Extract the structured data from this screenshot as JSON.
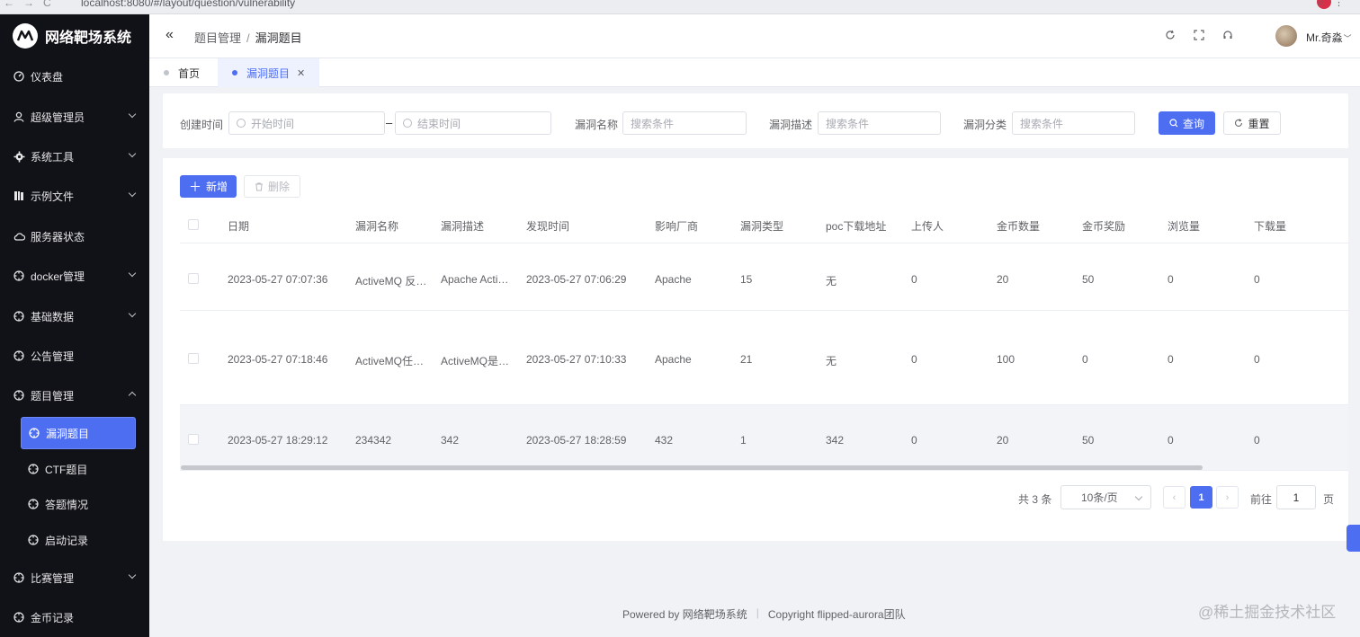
{
  "browser": {
    "url": "localhost:8080/#/layout/question/vulnerability"
  },
  "app": {
    "title": "网络靶场系统"
  },
  "sidebar": {
    "items": [
      {
        "label": "仪表盘",
        "icon": "dashboard-icon"
      },
      {
        "label": "超级管理员",
        "icon": "user-icon"
      },
      {
        "label": "系统工具",
        "icon": "tools-icon"
      },
      {
        "label": "示例文件",
        "icon": "folder-icon"
      },
      {
        "label": "服务器状态",
        "icon": "cloud-icon"
      },
      {
        "label": "docker管理",
        "icon": "aim-icon"
      },
      {
        "label": "基础数据",
        "icon": "aim-icon"
      },
      {
        "label": "公告管理",
        "icon": "aim-icon"
      },
      {
        "label": "题目管理",
        "icon": "aim-icon"
      },
      {
        "label": "比赛管理",
        "icon": "aim-icon"
      },
      {
        "label": "金币记录",
        "icon": "aim-icon"
      }
    ],
    "sub_items": [
      {
        "label": "漏洞题目",
        "active": true
      },
      {
        "label": "CTF题目",
        "active": false
      },
      {
        "label": "答题情况",
        "active": false
      },
      {
        "label": "启动记录",
        "active": false
      }
    ]
  },
  "header": {
    "breadcrumb_parent": "题目管理",
    "breadcrumb_sep": "/",
    "breadcrumb_current": "漏洞题目",
    "username": "Mr.奇淼"
  },
  "tabs": [
    {
      "label": "首页",
      "active": false
    },
    {
      "label": "漏洞题目",
      "active": true
    }
  ],
  "search": {
    "created_label": "创建时间",
    "start_placeholder": "开始时间",
    "range_sep": "–",
    "end_placeholder": "结束时间",
    "name_label": "漏洞名称",
    "name_placeholder": "搜索条件",
    "desc_label": "漏洞描述",
    "desc_placeholder": "搜索条件",
    "category_label": "漏洞分类",
    "category_placeholder": "搜索条件",
    "query_label": "查询",
    "reset_label": "重置"
  },
  "toolbar": {
    "add_label": "新增",
    "delete_label": "删除"
  },
  "table": {
    "columns": [
      "日期",
      "漏洞名称",
      "漏洞描述",
      "发现时间",
      "影响厂商",
      "漏洞类型",
      "poc下载地址",
      "上传人",
      "金币数量",
      "金币奖励",
      "浏览量",
      "下载量"
    ],
    "rows": [
      [
        "2023-05-27 07:07:36",
        "ActiveMQ 反…",
        "Apache Acti…",
        "2023-05-27 07:06:29",
        "Apache",
        "15",
        "无",
        "0",
        "20",
        "50",
        "0",
        "0"
      ],
      [
        "2023-05-27 07:18:46",
        "ActiveMQ任…",
        "ActiveMQ是…",
        "2023-05-27 07:10:33",
        "Apache",
        "21",
        "无",
        "0",
        "100",
        "0",
        "0",
        "0"
      ],
      [
        "2023-05-27 18:29:12",
        "234342",
        "342",
        "2023-05-27 18:28:59",
        "432",
        "1",
        "342",
        "0",
        "20",
        "50",
        "0",
        "0"
      ]
    ]
  },
  "pagination": {
    "total": "共 3 条",
    "page_size": "10条/页",
    "prev": "‹",
    "current": "1",
    "next": "›",
    "goto_label": "前往",
    "goto_value": "1",
    "page_suffix": "页"
  },
  "footer": {
    "powered": "Powered by",
    "powered_name": "网络靶场系统",
    "divider": "|",
    "copyright": "Copyright",
    "copyright_name": "flipped-aurora团队"
  },
  "watermark": "@稀土掘金技术社区",
  "colors": {
    "primary": "#4e6ef2",
    "sidebar_bg": "#111217",
    "page_bg": "#f0f2f5"
  }
}
